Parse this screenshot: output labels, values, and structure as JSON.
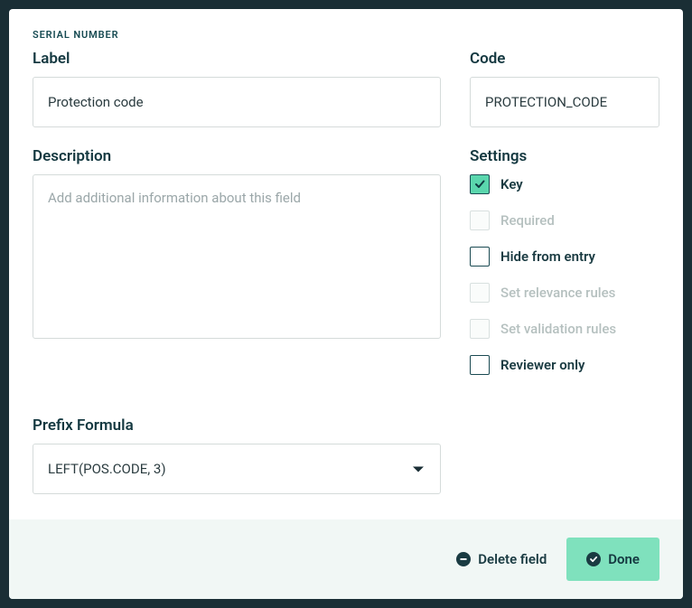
{
  "field_type": "SERIAL NUMBER",
  "labels": {
    "label": "Label",
    "code": "Code",
    "description": "Description",
    "settings": "Settings",
    "prefix_formula": "Prefix Formula"
  },
  "values": {
    "label": "Protection code",
    "code": "PROTECTION_CODE",
    "description": "",
    "prefix_formula": "LEFT(POS.CODE, 3)"
  },
  "placeholders": {
    "description": "Add additional information about this field"
  },
  "settings": [
    {
      "key": "key",
      "label": "Key",
      "checked": true,
      "disabled": false
    },
    {
      "key": "required",
      "label": "Required",
      "checked": false,
      "disabled": true
    },
    {
      "key": "hide_from_entry",
      "label": "Hide from entry",
      "checked": false,
      "disabled": false
    },
    {
      "key": "relevance",
      "label": "Set relevance rules",
      "checked": false,
      "disabled": true
    },
    {
      "key": "validation",
      "label": "Set validation rules",
      "checked": false,
      "disabled": true
    },
    {
      "key": "reviewer_only",
      "label": "Reviewer only",
      "checked": false,
      "disabled": false
    }
  ],
  "buttons": {
    "delete": "Delete field",
    "done": "Done"
  }
}
